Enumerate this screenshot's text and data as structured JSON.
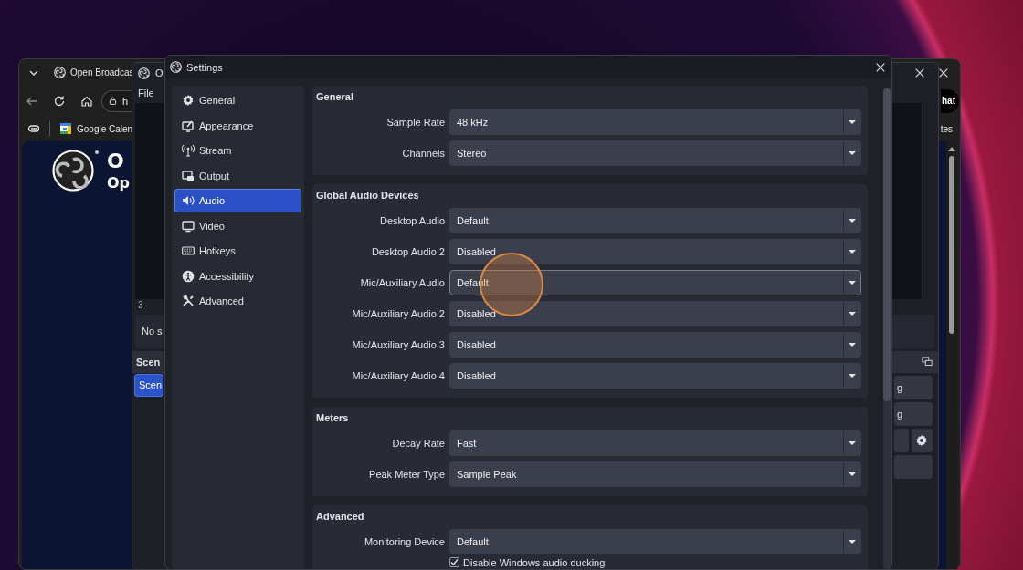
{
  "browser": {
    "tab_title": "Open Broadcas",
    "address": "h",
    "bookmarks": [
      "Google Calen"
    ],
    "right_button": "hat",
    "right_bookmark": "tes",
    "page": {
      "heading": "O",
      "subheading": "Op"
    }
  },
  "obs": {
    "title": "O",
    "menu": [
      "File"
    ],
    "zoom_label": "3",
    "sources_text": "No s",
    "scenes_title": "Scen",
    "scenes": [
      {
        "label": "Scen",
        "selected": true
      }
    ],
    "controls": [
      "g",
      "g"
    ]
  },
  "settings": {
    "title": "Settings",
    "nav": [
      {
        "label": "General",
        "selected": false
      },
      {
        "label": "Appearance",
        "selected": false
      },
      {
        "label": "Stream",
        "selected": false
      },
      {
        "label": "Output",
        "selected": false
      },
      {
        "label": "Audio",
        "selected": true
      },
      {
        "label": "Video",
        "selected": false
      },
      {
        "label": "Hotkeys",
        "selected": false
      },
      {
        "label": "Accessibility",
        "selected": false
      },
      {
        "label": "Advanced",
        "selected": false
      }
    ],
    "groups": [
      {
        "title": "General",
        "rows": [
          {
            "kind": "combo",
            "label": "Sample Rate",
            "value": "48 kHz",
            "hovered": false
          },
          {
            "kind": "combo",
            "label": "Channels",
            "value": "Stereo",
            "hovered": false
          }
        ]
      },
      {
        "title": "Global Audio Devices",
        "rows": [
          {
            "kind": "combo",
            "label": "Desktop Audio",
            "value": "Default",
            "hovered": false
          },
          {
            "kind": "combo",
            "label": "Desktop Audio 2",
            "value": "Disabled",
            "hovered": false
          },
          {
            "kind": "combo",
            "label": "Mic/Auxiliary Audio",
            "value": "Default",
            "hovered": true
          },
          {
            "kind": "combo",
            "label": "Mic/Auxiliary Audio 2",
            "value": "Disabled",
            "hovered": false
          },
          {
            "kind": "combo",
            "label": "Mic/Auxiliary Audio 3",
            "value": "Disabled",
            "hovered": false
          },
          {
            "kind": "combo",
            "label": "Mic/Auxiliary Audio 4",
            "value": "Disabled",
            "hovered": false
          }
        ]
      },
      {
        "title": "Meters",
        "rows": [
          {
            "kind": "combo",
            "label": "Decay Rate",
            "value": "Fast",
            "hovered": false
          },
          {
            "kind": "combo",
            "label": "Peak Meter Type",
            "value": "Sample Peak",
            "hovered": false
          }
        ]
      },
      {
        "title": "Advanced",
        "rows": [
          {
            "kind": "combo",
            "label": "Monitoring Device",
            "value": "Default",
            "hovered": false
          },
          {
            "kind": "checkbox",
            "label": "Disable Windows audio ducking",
            "checked": true
          }
        ]
      }
    ]
  }
}
